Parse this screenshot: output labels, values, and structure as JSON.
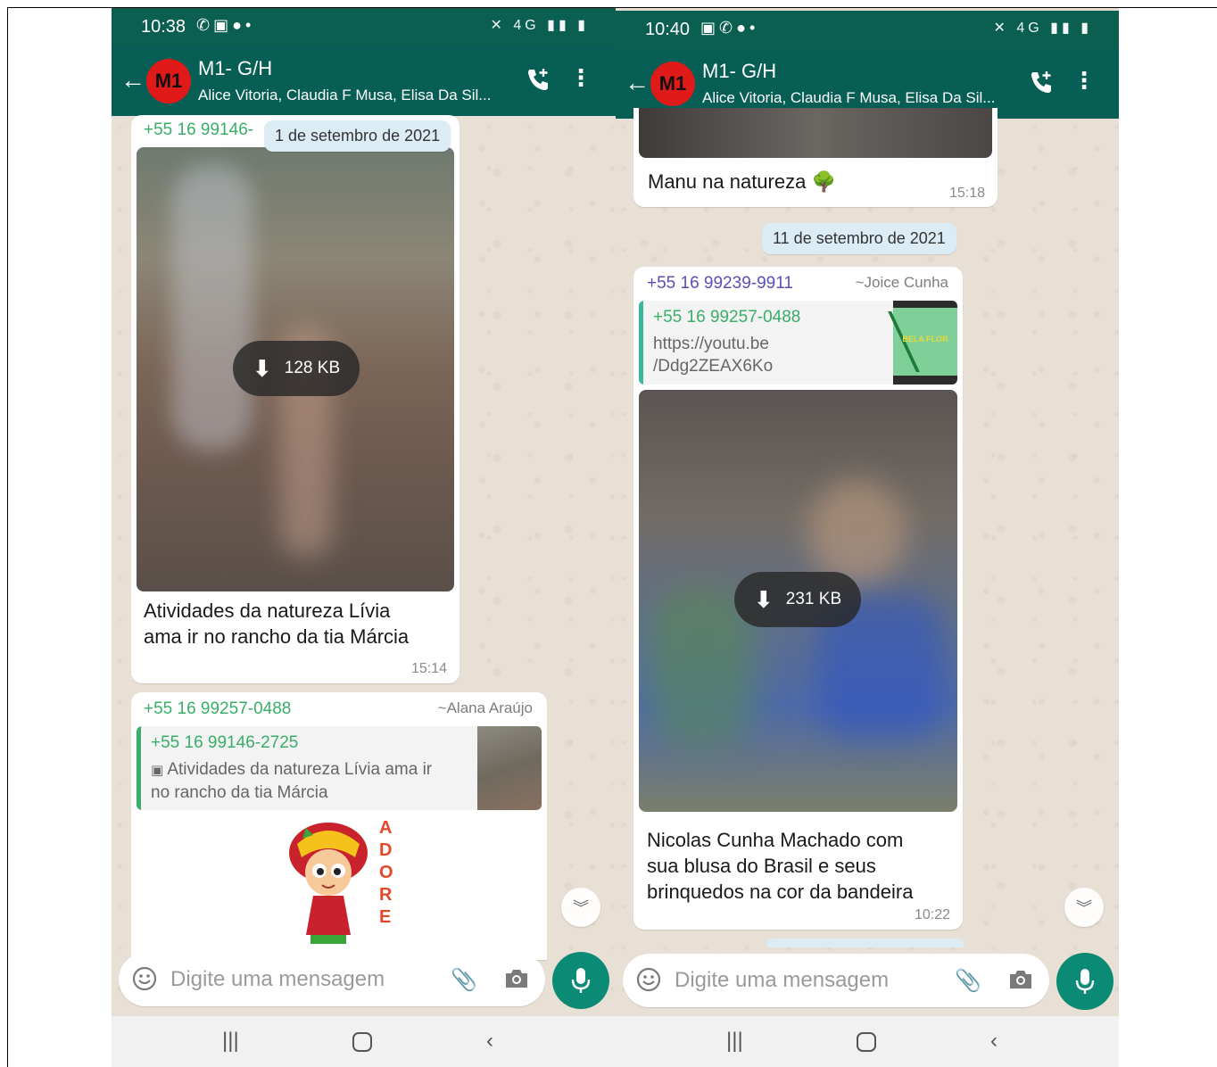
{
  "colors": {
    "header": "#075e54",
    "accent_green": "#39ae68",
    "mic_button": "#0b8a76",
    "date_chip": "#dcecf5"
  },
  "icons": {
    "back": "arrow-left-icon",
    "call": "add-call-icon",
    "menu": "more-vert-icon",
    "download": "download-icon",
    "emoji": "emoji-icon",
    "attach": "paperclip-icon",
    "camera": "camera-icon",
    "mic": "microphone-icon",
    "scroll": "double-chevron-down-icon",
    "nav_recents": "recents-icon",
    "nav_home": "home-icon",
    "nav_back": "nav-back-icon"
  },
  "left": {
    "status_time": "10:38",
    "chat_title": "M1- G/H",
    "avatar_text": "M1",
    "participants": "Alice Vitoria, Claudia F Musa, Elisa Da Sil...",
    "date_chip": "1 de setembro de 2021",
    "msg1": {
      "sender": "+55 16 99146-",
      "download_size": "128 KB",
      "caption_line1": "Atividades da natureza Lívia",
      "caption_line2": "ama ir no rancho da tia Márcia",
      "time": "15:14"
    },
    "msg2": {
      "sender": "+55 16 99257-0488",
      "push_name": "~Alana Araújo",
      "quote_sender": "+55 16 99146-2725",
      "quote_line1": "Atividades da natureza Lívia ama ir",
      "quote_line2": "no rancho da tia Márcia",
      "sticker_letters": [
        "A",
        "D",
        "O",
        "R",
        "E"
      ]
    },
    "input_placeholder": "Digite uma mensagem"
  },
  "right": {
    "status_time": "10:40",
    "chat_title": "M1- G/H",
    "avatar_text": "M1",
    "participants": "Alice Vitoria, Claudia F Musa, Elisa Da Sil...",
    "msg0": {
      "caption": "Manu na natureza 🌳",
      "time": "15:18"
    },
    "date_chip": "11 de setembro de 2021",
    "msg1": {
      "sender": "+55 16 99239-9911",
      "push_name": "~Joice Cunha",
      "quote_sender": "+55 16 99257-0488",
      "quote_line1": "https://youtu.be",
      "quote_line2": "/Ddg2ZEAX6Ko",
      "thumb_text": "BELA FLOR",
      "download_size": "231 KB",
      "caption_line1": "Nicolas Cunha Machado com",
      "caption_line2": "sua blusa do Brasil e seus",
      "caption_line3": "brinquedos na cor da bandeira",
      "time": "10:22"
    },
    "input_placeholder": "Digite uma mensagem"
  }
}
